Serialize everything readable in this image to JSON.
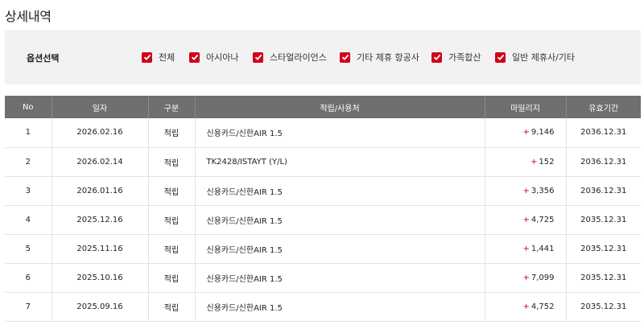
{
  "title": "상세내역",
  "options": {
    "label": "옵션선택",
    "items": [
      {
        "label": "전체",
        "checked": true
      },
      {
        "label": "아시아나",
        "checked": true
      },
      {
        "label": "스타얼라이언스",
        "checked": true
      },
      {
        "label": "기타 제휴 항공사",
        "checked": true
      },
      {
        "label": "가족합산",
        "checked": true
      },
      {
        "label": "일반 제휴사/기타",
        "checked": true
      }
    ]
  },
  "table": {
    "headers": [
      "No",
      "일자",
      "구분",
      "적립/사용처",
      "마일리지",
      "유효기간"
    ],
    "rows": [
      {
        "no": "1",
        "date": "2026.02.16",
        "type": "적립",
        "place": "신용카드/신한AIR 1.5",
        "sign": "+",
        "miles": "9,146",
        "expiry": "2036.12.31"
      },
      {
        "no": "2",
        "date": "2026.02.14",
        "type": "적립",
        "place": "TK2428/ISTAYT (Y/L)",
        "sign": "+",
        "miles": "152",
        "expiry": "2036.12.31"
      },
      {
        "no": "3",
        "date": "2026.01.16",
        "type": "적립",
        "place": "신용카드/신한AIR 1.5",
        "sign": "+",
        "miles": "3,356",
        "expiry": "2036.12.31"
      },
      {
        "no": "4",
        "date": "2025.12.16",
        "type": "적립",
        "place": "신용카드/신한AIR 1.5",
        "sign": "+",
        "miles": "4,725",
        "expiry": "2035.12.31"
      },
      {
        "no": "5",
        "date": "2025.11.16",
        "type": "적립",
        "place": "신용카드/신한AIR 1.5",
        "sign": "+",
        "miles": "1,441",
        "expiry": "2035.12.31"
      },
      {
        "no": "6",
        "date": "2025.10.16",
        "type": "적립",
        "place": "신용카드/신한AIR 1.5",
        "sign": "+",
        "miles": "7,099",
        "expiry": "2035.12.31"
      },
      {
        "no": "7",
        "date": "2025.09.16",
        "type": "적립",
        "place": "신용카드/신한AIR 1.5",
        "sign": "+",
        "miles": "4,752",
        "expiry": "2035.12.31"
      }
    ]
  },
  "colors": {
    "accent": "#d0021b",
    "header_bg": "#6f6f6f",
    "options_bg": "#f2f2f2"
  },
  "icons": {
    "checkbox": "checkmark-icon"
  }
}
